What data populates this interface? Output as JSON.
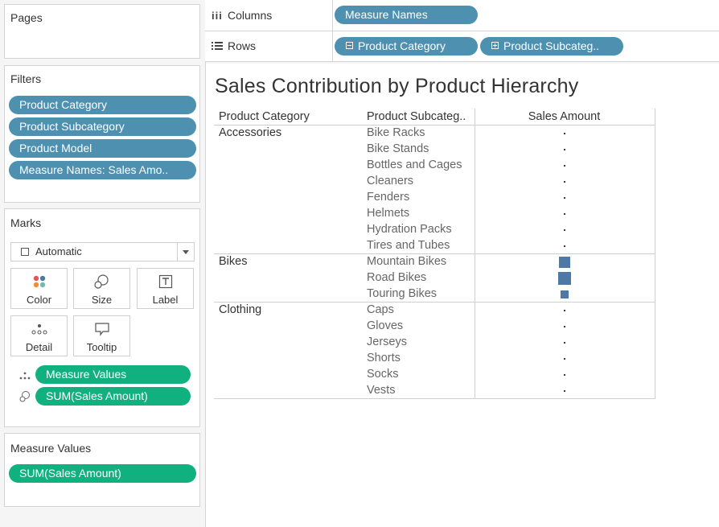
{
  "pages": {
    "title": "Pages"
  },
  "filters": {
    "title": "Filters",
    "items": [
      "Product Category",
      "Product Subcategory",
      "Product Model",
      "Measure Names: Sales Amo.."
    ]
  },
  "marks": {
    "title": "Marks",
    "type": "Automatic",
    "cards": [
      "Color",
      "Size",
      "Label",
      "Detail",
      "Tooltip"
    ],
    "pills": [
      "Measure Values",
      "SUM(Sales Amount)"
    ]
  },
  "measure_values": {
    "title": "Measure Values",
    "items": [
      "SUM(Sales Amount)"
    ]
  },
  "shelves": {
    "columns_label": "Columns",
    "columns_pill": "Measure Names",
    "rows_label": "Rows",
    "rows_pills": [
      "Product Category",
      "Product Subcateg.."
    ]
  },
  "viz": {
    "title": "Sales Contribution by Product Hierarchy",
    "headers": [
      "Product Category",
      "Product Subcateg..",
      "Sales Amount"
    ],
    "categories": [
      {
        "name": "Accessories",
        "subs": [
          "Bike Racks",
          "Bike Stands",
          "Bottles and Cages",
          "Cleaners",
          "Fenders",
          "Helmets",
          "Hydration Packs",
          "Tires and Tubes"
        ]
      },
      {
        "name": "Bikes",
        "subs": [
          "Mountain Bikes",
          "Road Bikes",
          "Touring Bikes"
        ]
      },
      {
        "name": "Clothing",
        "subs": [
          "Caps",
          "Gloves",
          "Jerseys",
          "Shorts",
          "Socks",
          "Vests"
        ]
      }
    ]
  },
  "chart_data": {
    "type": "table",
    "title": "Sales Contribution by Product Hierarchy",
    "mark_color": "#4e79a7",
    "categories": [
      "Bike Racks",
      "Bike Stands",
      "Bottles and Cages",
      "Cleaners",
      "Fenders",
      "Helmets",
      "Hydration Packs",
      "Tires and Tubes",
      "Mountain Bikes",
      "Road Bikes",
      "Touring Bikes",
      "Caps",
      "Gloves",
      "Jerseys",
      "Shorts",
      "Socks",
      "Vests"
    ],
    "relative_size": [
      0.01,
      0.01,
      0.02,
      0.005,
      0.01,
      0.01,
      0.01,
      0.01,
      0.6,
      0.75,
      0.3,
      0.005,
      0.005,
      0.005,
      0.005,
      0.005,
      0.005
    ]
  }
}
